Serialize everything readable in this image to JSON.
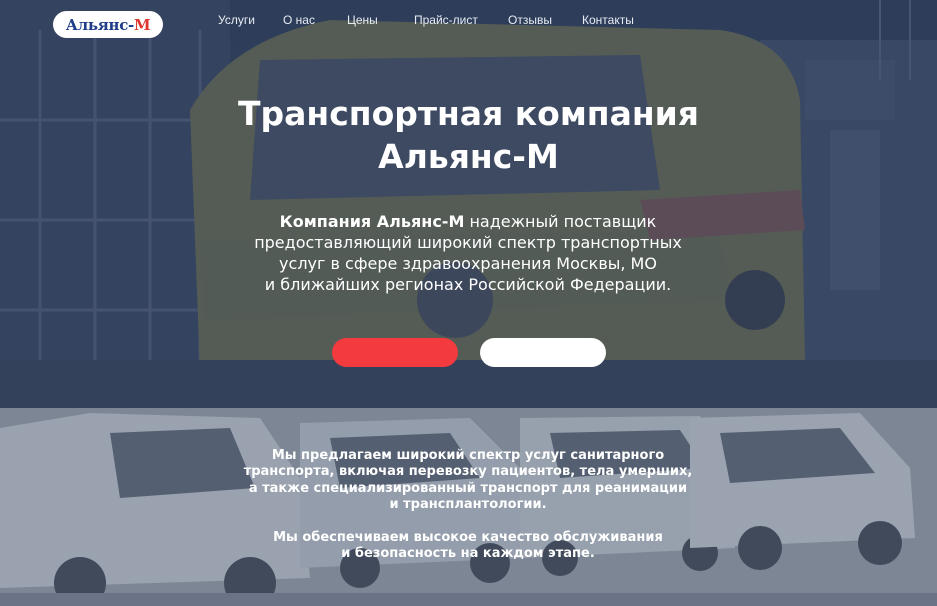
{
  "brand": {
    "logo_main": "Альянс-",
    "logo_accent": "М"
  },
  "nav": {
    "items": [
      "Услуги",
      "О нас",
      "Цены",
      "Прайс-лист",
      "Отзывы",
      "Контакты"
    ]
  },
  "hero": {
    "title_line1": "Транспортная компания",
    "title_line2": "Альянс-М",
    "desc_bold": "Компания Альянс-М",
    "desc_line1_rest": " надежный поставщик",
    "desc_line2": "предоставляющий широкий спектр транспортных",
    "desc_line3": "услуг в сфере здравоохранения Москвы, МО",
    "desc_line4": "и ближайших регионах Российской Федерации.",
    "primary_button": "",
    "secondary_button": ""
  },
  "services": {
    "para1_line1": "Мы предлагаем широкий спектр услуг санитарного",
    "para1_line2": "транспорта, включая перевозку пациентов, тела умерших,",
    "para1_line3": "а также специализированный транспорт для реанимации",
    "para1_line4": "и трансплантологии.",
    "para2_line1": "Мы обеспечиваем высокое качество обслуживания",
    "para2_line2": "и безопасность на каждом этапе."
  },
  "colors": {
    "accent_red": "#f23a3f",
    "hero_overlay": "#33435d",
    "logo_blue": "#1f3d8a"
  }
}
